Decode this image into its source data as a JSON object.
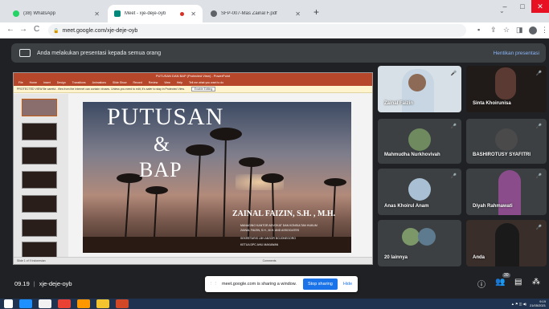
{
  "tabs": [
    {
      "title": "(38) WhatsApp",
      "icon": "whatsapp-icon",
      "color": "#25d366"
    },
    {
      "title": "Meet - xje-deje-oyb",
      "icon": "meet-icon",
      "color": "#00897b"
    },
    {
      "title": "SFP-007-Mas Zainal F.pdf",
      "icon": "pdf-icon",
      "color": "#5f6368"
    }
  ],
  "address": {
    "url": "meet.google.com/xje-deje-oyb"
  },
  "presenting_bar": {
    "text": "Anda melakukan presentasi kepada semua orang",
    "stop_label": "Hentikan presentasi"
  },
  "ppt": {
    "window_title": "PUTUSAN DAN BAP (Protected View) - PowerPoint",
    "menu": [
      "File",
      "Home",
      "Insert",
      "Design",
      "Transitions",
      "Animations",
      "Slide Show",
      "Record",
      "Review",
      "View",
      "Help",
      "Tell me what you want to do"
    ],
    "protected_text": "PROTECTED VIEW  Be careful - files from the Internet can contain viruses. Unless you need to edit, it's safer to stay in Protected View.",
    "enable_label": "Enable Editing",
    "slide": {
      "line1": "PUTUSAN",
      "line2": "&",
      "line3": "BAP",
      "presenter": "ZAINAL FAIZIN, S.H. , M.H.",
      "sub1": "MANAGING KANTOR ADVOKAT DAN KONSULTAN HUKUM",
      "sub2": "ZAINAL FAIZIN, S.H., M.H. AND ASSOCIATES",
      "sub3": "SEKRETARIS LBH ANSOR BOJONEGORO",
      "sub4": "KETUA DPC AHLI MAKAWAN"
    },
    "status_left": "Slide 1 of 9    Indonesian",
    "status_right": "Comments"
  },
  "participants": [
    {
      "name": "Zainal Faizin",
      "avatar_color": "#c7d6e2"
    },
    {
      "name": "Sinta Khoirunisa",
      "avatar_color": "#5a3a32"
    },
    {
      "name": "Mahmudha Nurkhovivah",
      "avatar_color": "#6e8a5e"
    },
    {
      "name": "BASHIROTUSY SYAFITRI",
      "avatar_color": "#4a4a4a"
    },
    {
      "name": "Anas Khoirul Anam",
      "avatar_color": "#a9bfd3"
    },
    {
      "name": "Diyah Rahmawati",
      "avatar_color": "#c8b3c8"
    },
    {
      "name": "20 lainnya",
      "avatar_color": "#7d9868"
    },
    {
      "name": "Anda",
      "avatar_color": "#1a1a1a"
    }
  ],
  "bottom": {
    "time": "09.19",
    "meeting_code": "xje-deje-oyb",
    "share_text": "meet.google.com is sharing a window.",
    "stop_sharing": "Stop sharing",
    "hide": "Hide",
    "people_count": "30"
  },
  "taskbar": {
    "clock_time": "9:19",
    "clock_date": "21/05/2021"
  }
}
